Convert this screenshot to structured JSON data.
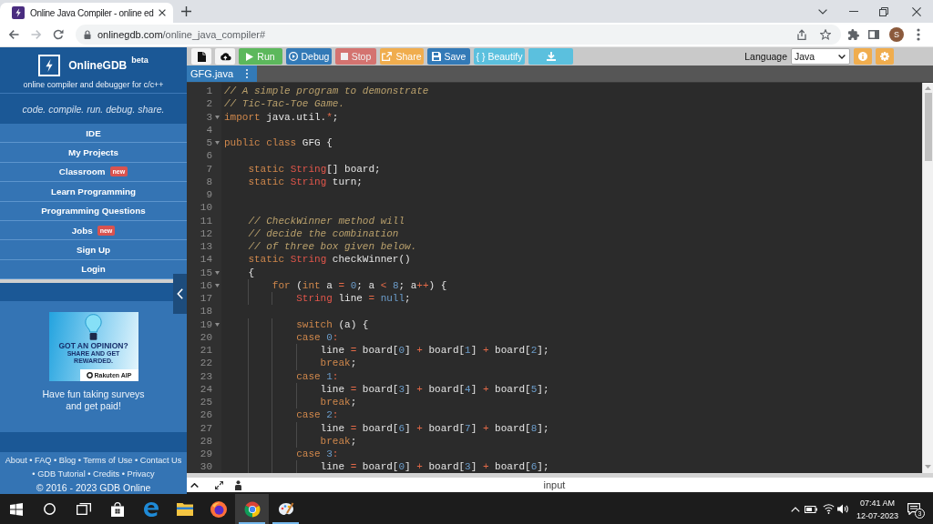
{
  "browser": {
    "tab_title": "Online Java Compiler - online ed",
    "url_host": "onlinegdb.com",
    "url_path": "/online_java_compiler#",
    "avatar": "S"
  },
  "sidebar": {
    "brand": "OnlineGDB",
    "brand_badge": "beta",
    "subtitle": "online compiler and debugger for c/c++",
    "tagline": "code. compile. run. debug. share.",
    "menu": [
      {
        "label": "IDE"
      },
      {
        "label": "My Projects"
      },
      {
        "label": "Classroom",
        "badge": "new"
      },
      {
        "label": "Learn Programming"
      },
      {
        "label": "Programming Questions"
      },
      {
        "label": "Jobs",
        "badge": "new"
      },
      {
        "label": "Sign Up"
      },
      {
        "label": "Login"
      }
    ],
    "ad": {
      "headline": "GOT AN OPINION?",
      "subheadline": "SHARE AND GET REWARDED.",
      "brand": "Rakuten AIP",
      "caption": "Have fun taking surveys and get paid!"
    },
    "footer": {
      "links": [
        {
          "label": "About"
        },
        {
          "separator": "•",
          "label": "FAQ"
        },
        {
          "separator": "•",
          "label": "Blog"
        },
        {
          "separator": "•",
          "label": "Terms of Use"
        },
        {
          "separator": "•",
          "label": "Contact Us"
        },
        {
          "separator": "•",
          "label": "GDB Tutorial"
        },
        {
          "separator": "•",
          "label": "Credits"
        },
        {
          "separator": "•",
          "label": "Privacy"
        }
      ],
      "copyright": "© 2016 - 2023 GDB Online"
    }
  },
  "toolbar": {
    "buttons": [
      {
        "kind": "file",
        "disabled": false
      },
      {
        "kind": "upload",
        "disabled": false
      },
      {
        "kind": "run",
        "label": "Run",
        "disabled": false
      },
      {
        "kind": "debug",
        "label": "Debug",
        "disabled": false
      },
      {
        "kind": "stop",
        "label": "Stop",
        "disabled": true
      },
      {
        "kind": "share",
        "label": "Share",
        "disabled": false
      },
      {
        "kind": "save",
        "label": "Save",
        "disabled": false
      },
      {
        "kind": "beautify",
        "label": "{ } Beautify",
        "disabled": false
      },
      {
        "kind": "download",
        "disabled": false
      }
    ],
    "language": {
      "label": "Language",
      "value": "Java"
    }
  },
  "editor": {
    "tabs": [
      {
        "name": "GFG.java",
        "selected": true
      }
    ],
    "lines": [
      {
        "number": "1",
        "foldable": false,
        "tokens": [
          {
            "kind": "comment",
            "text": "// A simple program to demonstrate"
          }
        ]
      },
      {
        "number": "2",
        "foldable": false,
        "tokens": [
          {
            "kind": "comment",
            "text": "// Tic-Tac-Toe Game."
          }
        ]
      },
      {
        "number": "3",
        "foldable": true,
        "tokens": [
          {
            "kind": "keyword",
            "text": "import"
          },
          {
            "kind": "plain",
            "text": " java.util."
          },
          {
            "kind": "operator",
            "text": "*"
          },
          {
            "kind": "plain",
            "text": ";"
          }
        ]
      },
      {
        "number": "4",
        "foldable": false
      },
      {
        "number": "5",
        "foldable": true,
        "tokens": [
          {
            "kind": "keyword",
            "text": "public class"
          },
          {
            "kind": "plain",
            "text": " GFG {"
          }
        ]
      },
      {
        "number": "6",
        "foldable": false
      },
      {
        "number": "7",
        "foldable": false,
        "tokens": [
          {
            "kind": "keyword",
            "text": "    static "
          },
          {
            "kind": "type",
            "text": "String"
          },
          {
            "kind": "plain",
            "text": "[] board;"
          }
        ]
      },
      {
        "number": "8",
        "foldable": false,
        "tokens": [
          {
            "kind": "keyword",
            "text": "    static "
          },
          {
            "kind": "type",
            "text": "String"
          },
          {
            "kind": "plain",
            "text": " turn;"
          }
        ]
      },
      {
        "number": "9",
        "foldable": false
      },
      {
        "number": "10",
        "foldable": false
      },
      {
        "number": "11",
        "foldable": false,
        "tokens": [
          {
            "kind": "comment",
            "text": "    // CheckWinner method will"
          }
        ]
      },
      {
        "number": "12",
        "foldable": false,
        "tokens": [
          {
            "kind": "comment",
            "text": "    // decide the combination"
          }
        ]
      },
      {
        "number": "13",
        "foldable": false,
        "tokens": [
          {
            "kind": "comment",
            "text": "    // of three box given below."
          }
        ]
      },
      {
        "number": "14",
        "foldable": false,
        "tokens": [
          {
            "kind": "keyword",
            "text": "    static "
          },
          {
            "kind": "type",
            "text": "String"
          },
          {
            "kind": "plain",
            "text": " checkWinner()"
          }
        ]
      },
      {
        "number": "15",
        "foldable": true,
        "tokens": [
          {
            "kind": "plain",
            "text": "    {"
          }
        ]
      },
      {
        "number": "16",
        "foldable": true,
        "tokens": [
          {
            "kind": "keyword",
            "text": "        for"
          },
          {
            "kind": "plain",
            "text": " ("
          },
          {
            "kind": "keyword",
            "text": "int"
          },
          {
            "kind": "plain",
            "text": " a "
          },
          {
            "kind": "operator",
            "text": "="
          },
          {
            "kind": "number",
            "text": " 0"
          },
          {
            "kind": "plain",
            "text": "; a "
          },
          {
            "kind": "operator",
            "text": "<"
          },
          {
            "kind": "number",
            "text": " 8"
          },
          {
            "kind": "plain",
            "text": "; a"
          },
          {
            "kind": "operator",
            "text": "++"
          },
          {
            "kind": "plain",
            "text": ") {"
          }
        ]
      },
      {
        "number": "17",
        "foldable": false,
        "tokens": [
          {
            "kind": "type",
            "text": "            String"
          },
          {
            "kind": "plain",
            "text": " line "
          },
          {
            "kind": "operator",
            "text": "="
          },
          {
            "kind": "constant",
            "text": " null"
          },
          {
            "kind": "plain",
            "text": ";"
          }
        ]
      },
      {
        "number": "18",
        "foldable": false
      },
      {
        "number": "19",
        "foldable": true,
        "tokens": [
          {
            "kind": "keyword",
            "text": "            switch"
          },
          {
            "kind": "plain",
            "text": " (a) {"
          }
        ]
      },
      {
        "number": "20",
        "foldable": false,
        "tokens": [
          {
            "kind": "keyword",
            "text": "            case"
          },
          {
            "kind": "number",
            "text": " 0"
          },
          {
            "kind": "operator",
            "text": ":"
          }
        ]
      },
      {
        "number": "21",
        "foldable": false,
        "tokens": [
          {
            "kind": "plain",
            "text": "                line "
          },
          {
            "kind": "operator",
            "text": "="
          },
          {
            "kind": "plain",
            "text": " board["
          },
          {
            "kind": "number",
            "text": "0"
          },
          {
            "kind": "plain",
            "text": "] "
          },
          {
            "kind": "operator",
            "text": "+"
          },
          {
            "kind": "plain",
            "text": " board["
          },
          {
            "kind": "number",
            "text": "1"
          },
          {
            "kind": "plain",
            "text": "] "
          },
          {
            "kind": "operator",
            "text": "+"
          },
          {
            "kind": "plain",
            "text": " board["
          },
          {
            "kind": "number",
            "text": "2"
          },
          {
            "kind": "plain",
            "text": "];"
          }
        ]
      },
      {
        "number": "22",
        "foldable": false,
        "tokens": [
          {
            "kind": "keyword",
            "text": "                break"
          },
          {
            "kind": "plain",
            "text": ";"
          }
        ]
      },
      {
        "number": "23",
        "foldable": false,
        "tokens": [
          {
            "kind": "keyword",
            "text": "            case"
          },
          {
            "kind": "number",
            "text": " 1"
          },
          {
            "kind": "operator",
            "text": ":"
          }
        ]
      },
      {
        "number": "24",
        "foldable": false,
        "tokens": [
          {
            "kind": "plain",
            "text": "                line "
          },
          {
            "kind": "operator",
            "text": "="
          },
          {
            "kind": "plain",
            "text": " board["
          },
          {
            "kind": "number",
            "text": "3"
          },
          {
            "kind": "plain",
            "text": "] "
          },
          {
            "kind": "operator",
            "text": "+"
          },
          {
            "kind": "plain",
            "text": " board["
          },
          {
            "kind": "number",
            "text": "4"
          },
          {
            "kind": "plain",
            "text": "] "
          },
          {
            "kind": "operator",
            "text": "+"
          },
          {
            "kind": "plain",
            "text": " board["
          },
          {
            "kind": "number",
            "text": "5"
          },
          {
            "kind": "plain",
            "text": "];"
          }
        ]
      },
      {
        "number": "25",
        "foldable": false,
        "tokens": [
          {
            "kind": "keyword",
            "text": "                break"
          },
          {
            "kind": "plain",
            "text": ";"
          }
        ]
      },
      {
        "number": "26",
        "foldable": false,
        "tokens": [
          {
            "kind": "keyword",
            "text": "            case"
          },
          {
            "kind": "number",
            "text": " 2"
          },
          {
            "kind": "operator",
            "text": ":"
          }
        ]
      },
      {
        "number": "27",
        "foldable": false,
        "tokens": [
          {
            "kind": "plain",
            "text": "                line "
          },
          {
            "kind": "operator",
            "text": "="
          },
          {
            "kind": "plain",
            "text": " board["
          },
          {
            "kind": "number",
            "text": "6"
          },
          {
            "kind": "plain",
            "text": "] "
          },
          {
            "kind": "operator",
            "text": "+"
          },
          {
            "kind": "plain",
            "text": " board["
          },
          {
            "kind": "number",
            "text": "7"
          },
          {
            "kind": "plain",
            "text": "] "
          },
          {
            "kind": "operator",
            "text": "+"
          },
          {
            "kind": "plain",
            "text": " board["
          },
          {
            "kind": "number",
            "text": "8"
          },
          {
            "kind": "plain",
            "text": "];"
          }
        ]
      },
      {
        "number": "28",
        "foldable": false,
        "tokens": [
          {
            "kind": "keyword",
            "text": "                break"
          },
          {
            "kind": "plain",
            "text": ";"
          }
        ]
      },
      {
        "number": "29",
        "foldable": false,
        "tokens": [
          {
            "kind": "keyword",
            "text": "            case"
          },
          {
            "kind": "number",
            "text": " 3"
          },
          {
            "kind": "operator",
            "text": ":"
          }
        ]
      },
      {
        "number": "30",
        "foldable": false,
        "tokens": [
          {
            "kind": "plain",
            "text": "                line "
          },
          {
            "kind": "operator",
            "text": "="
          },
          {
            "kind": "plain",
            "text": " board["
          },
          {
            "kind": "number",
            "text": "0"
          },
          {
            "kind": "plain",
            "text": "] "
          },
          {
            "kind": "operator",
            "text": "+"
          },
          {
            "kind": "plain",
            "text": " board["
          },
          {
            "kind": "number",
            "text": "3"
          },
          {
            "kind": "plain",
            "text": "] "
          },
          {
            "kind": "operator",
            "text": "+"
          },
          {
            "kind": "plain",
            "text": " board["
          },
          {
            "kind": "number",
            "text": "6"
          },
          {
            "kind": "plain",
            "text": "];"
          }
        ]
      }
    ]
  },
  "io_panel": {
    "title": "input"
  },
  "taskbar": {
    "apps": [
      {
        "running": false,
        "selected": false
      },
      {
        "running": false,
        "selected": false
      },
      {
        "running": false,
        "selected": false
      },
      {
        "running": false,
        "selected": false
      },
      {
        "running": true,
        "selected": true
      },
      {
        "running": true,
        "selected": false
      }
    ],
    "clock": {
      "time": "07:41 AM",
      "date": "12-07-2023"
    },
    "notifications": "3"
  }
}
